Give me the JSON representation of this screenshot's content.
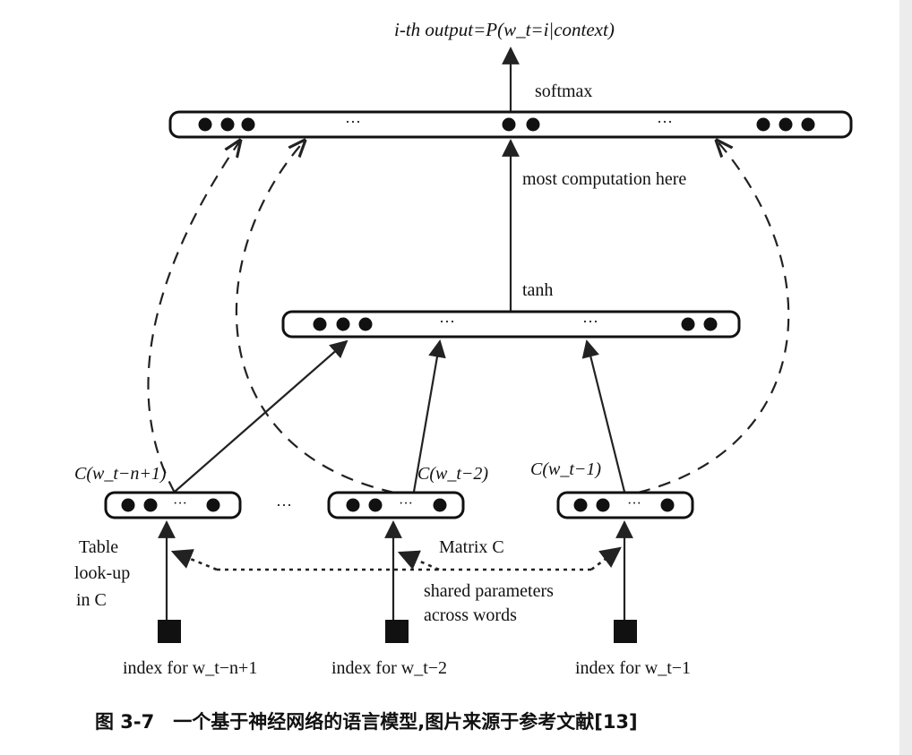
{
  "labels": {
    "output": "i-th output=P(w_t=i|context)",
    "softmax": "softmax",
    "most_computation": "most computation here",
    "tanh": "tanh",
    "ellipsis": "···",
    "between_embeddings": "···",
    "emb_left": "C(w_t−n+1)",
    "emb_mid": "C(w_t−2)",
    "emb_right": "C(w_t−1)",
    "table_lookup_line1": "Table",
    "table_lookup_line2": "look-up",
    "table_lookup_line3": "in C",
    "matrix_c": "Matrix C",
    "shared_line1": "shared parameters",
    "shared_line2": "across words",
    "index_left": "index for w_t−n+1",
    "index_mid": "index for w_t−2",
    "index_right": "index for w_t−1"
  },
  "caption": "图 3-7　一个基于神经网络的语言模型,图片来源于参考文献[13]"
}
